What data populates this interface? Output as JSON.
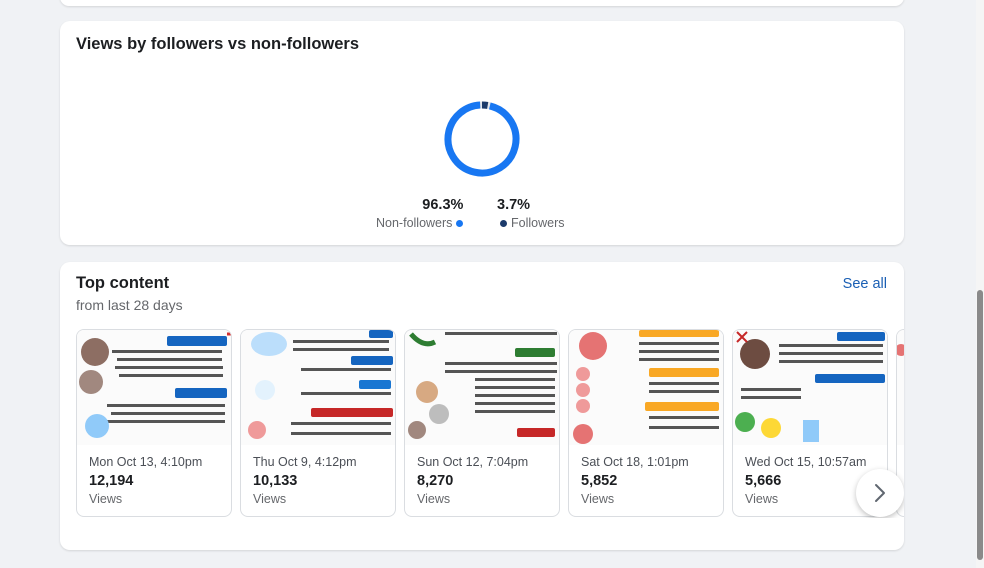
{
  "views_card": {
    "title": "Views by followers vs non-followers",
    "non_followers": {
      "percent": "96.3%",
      "label": "Non-followers",
      "fraction": 0.963,
      "color": "#1877f2"
    },
    "followers": {
      "percent": "3.7%",
      "label": "Followers",
      "fraction": 0.037,
      "color": "#1b3a6b"
    }
  },
  "top_content": {
    "title": "Top content",
    "subtitle": "from last 28 days",
    "see_all": "See all",
    "views_label": "Views",
    "next_icon": "chevron-right-icon",
    "posts": [
      {
        "date": "Mon Oct 13, 4:10pm",
        "views": "12,194"
      },
      {
        "date": "Thu Oct 9, 4:12pm",
        "views": "10,133"
      },
      {
        "date": "Sun Oct 12, 7:04pm",
        "views": "8,270"
      },
      {
        "date": "Sat Oct 18, 1:01pm",
        "views": "5,852"
      },
      {
        "date": "Wed Oct 15, 10:57am",
        "views": "5,666"
      }
    ]
  }
}
